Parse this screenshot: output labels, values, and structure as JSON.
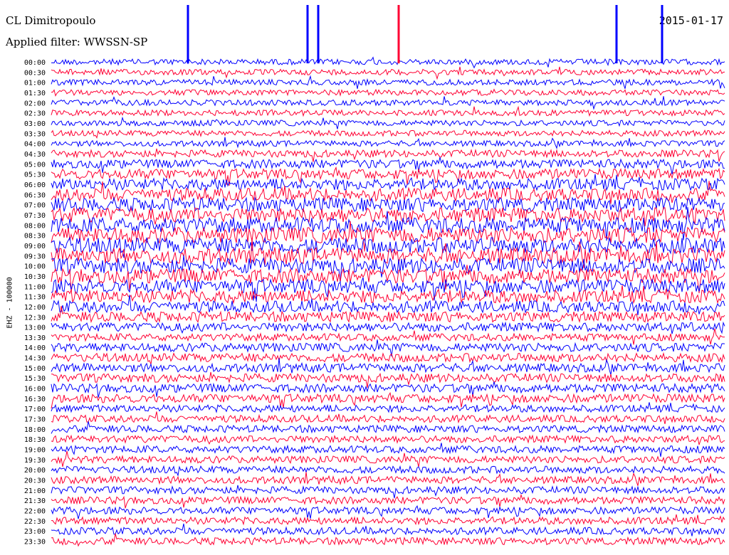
{
  "header": {
    "title": "CL Dimitropoulo",
    "filter": "Applied filter: WWSSN-SP",
    "date": "2015-01-17"
  },
  "chart_data": {
    "type": "line",
    "title": "CL Dimitropoulo",
    "subtitle": "Applied filter: WWSSN-SP",
    "date": "2015-01-17",
    "ylabel": "EHZ - 100000",
    "tick_labels": [
      "00:00",
      "00:30",
      "01:00",
      "01:30",
      "02:00",
      "02:30",
      "03:00",
      "03:30",
      "04:00",
      "04:30",
      "05:00",
      "05:30",
      "06:00",
      "06:30",
      "07:00",
      "07:30",
      "08:00",
      "08:30",
      "09:00",
      "09:30",
      "10:00",
      "10:30",
      "11:00",
      "11:30",
      "12:00",
      "12:30",
      "13:00",
      "13:30",
      "14:00",
      "14:30",
      "15:00",
      "15:30",
      "16:00",
      "16:30",
      "17:00",
      "17:30",
      "18:00",
      "18:30",
      "19:00",
      "19:30",
      "20:00",
      "20:30",
      "21:00",
      "21:30",
      "22:00",
      "22:30",
      "23:00",
      "23:30"
    ],
    "series_colors": [
      "#0000ff",
      "#ff0033"
    ],
    "legend": "none",
    "grid": false
  }
}
